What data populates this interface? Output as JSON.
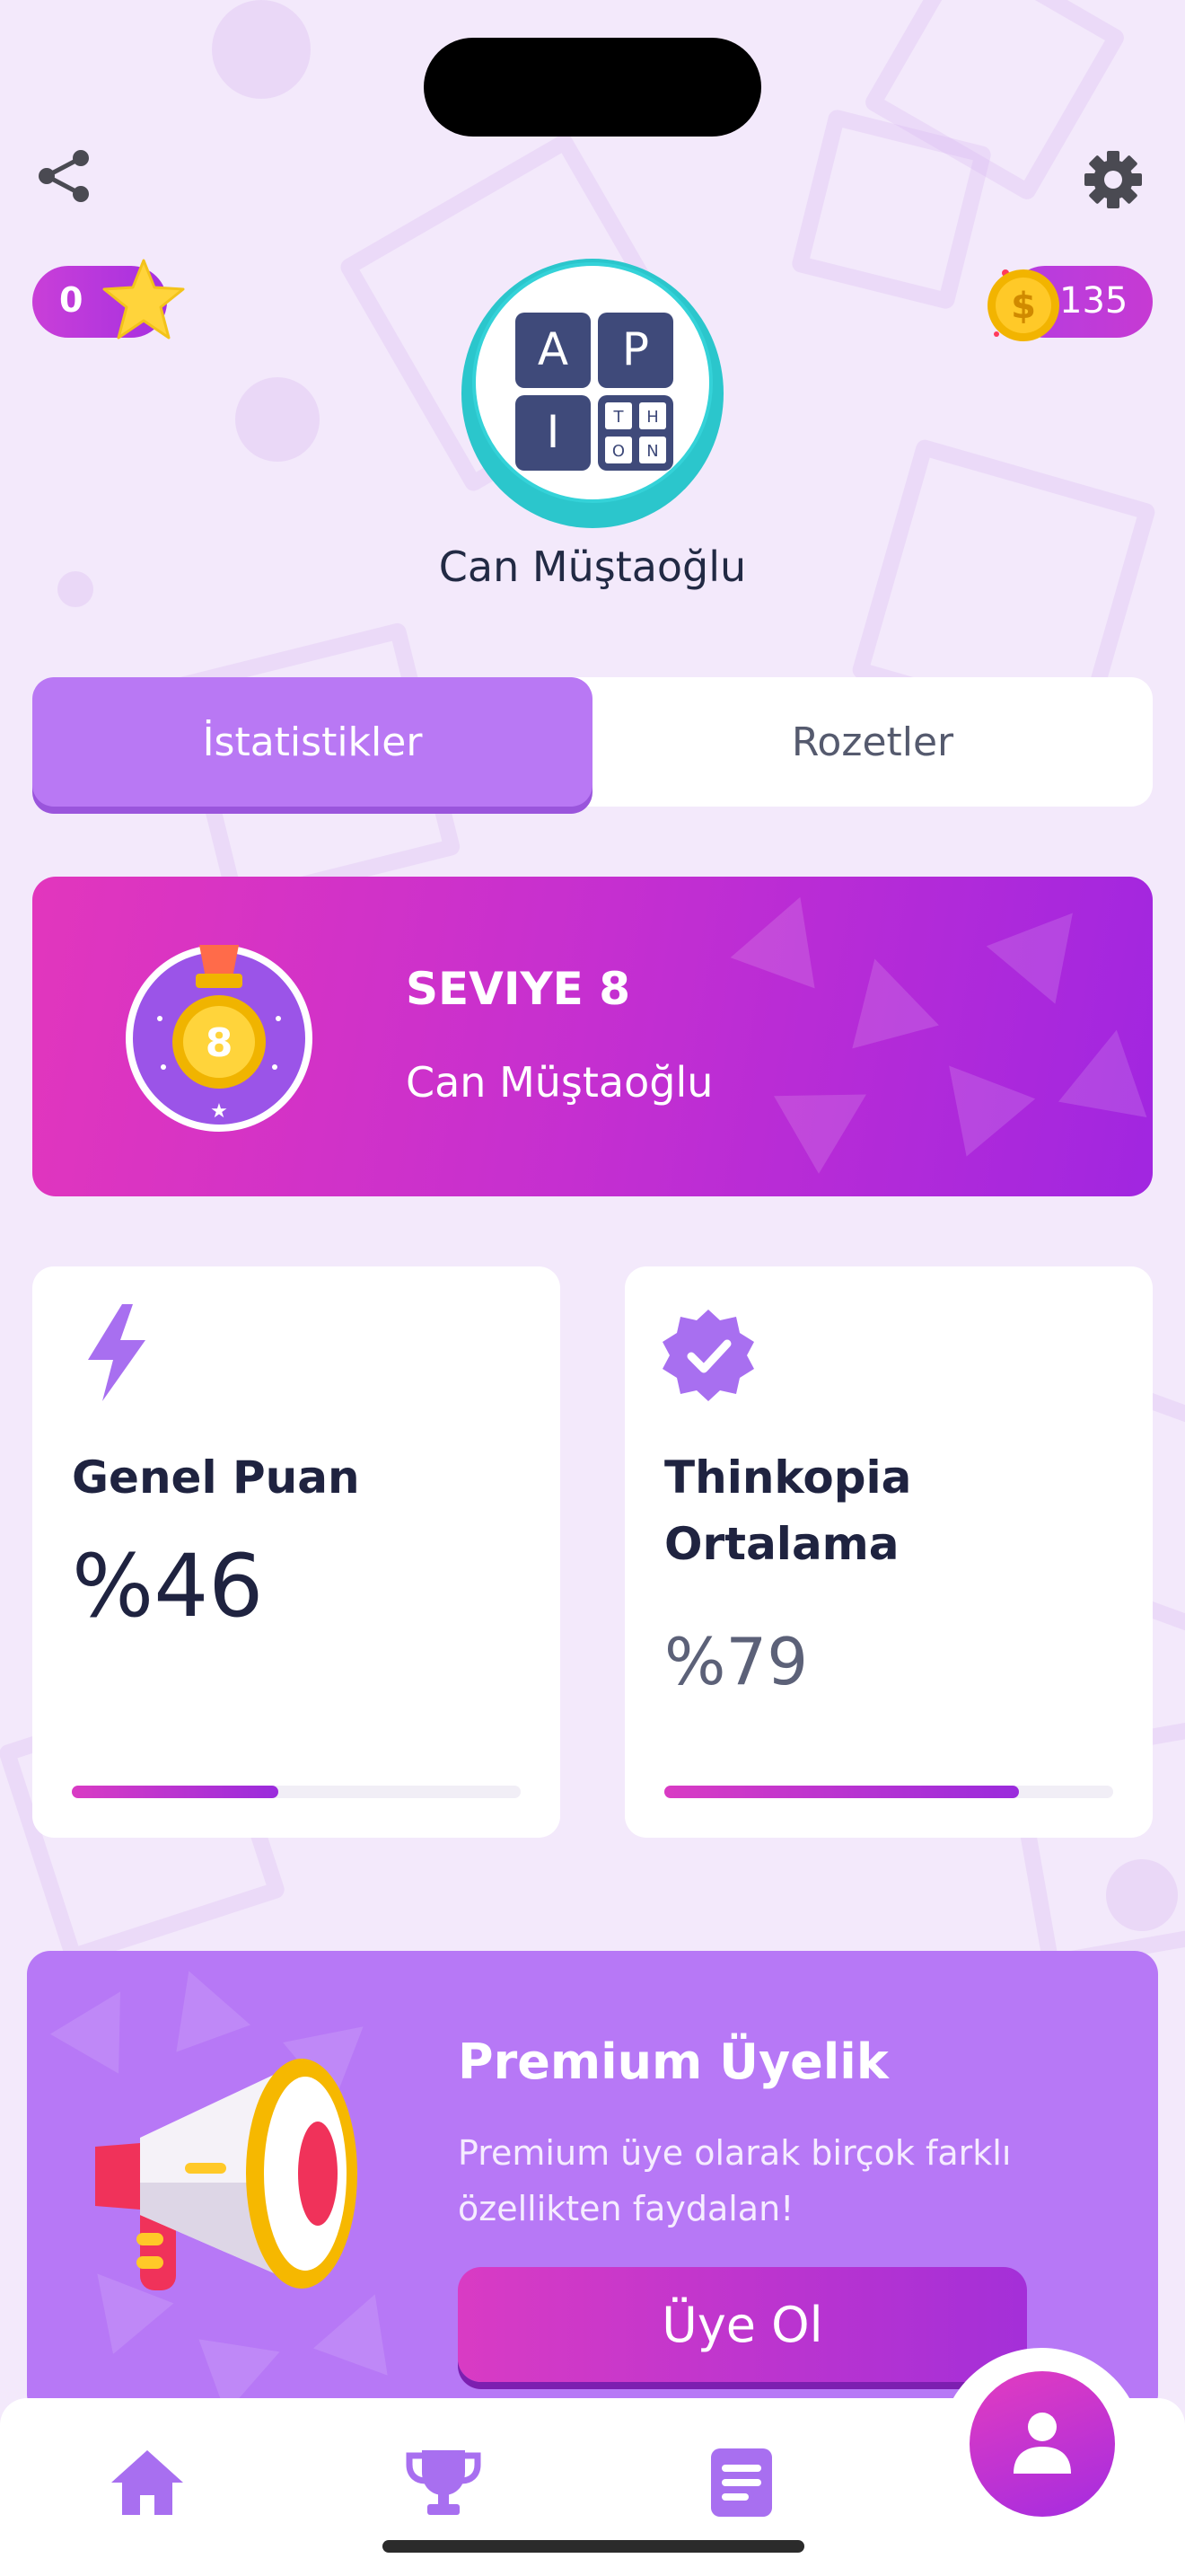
{
  "header": {
    "stars_count": "0",
    "coins_count": "135"
  },
  "profile": {
    "name": "Can Müştaoğlu",
    "logo_letters": [
      "A",
      "P",
      "I",
      "T",
      "H",
      "O",
      "N"
    ]
  },
  "tabs": [
    {
      "label": "İstatistikler",
      "active": true
    },
    {
      "label": "Rozetler",
      "active": false
    }
  ],
  "level_card": {
    "medal_number": "8",
    "title": "SEVIYE 8",
    "name": "Can Müştaoğlu"
  },
  "stats": [
    {
      "label": "Genel Puan",
      "value": "%46",
      "progress": 0.46,
      "icon": "lightning-icon"
    },
    {
      "label_line1": "Thinkopia",
      "label_line2": "Ortalama",
      "value": "%79",
      "progress": 0.79,
      "icon": "verified-badge-icon"
    }
  ],
  "premium": {
    "title": "Premium Üyelik",
    "description": "Premium üye olarak birçok farklı özellikten faydalan!",
    "button_label": "Üye Ol"
  },
  "colors": {
    "accent_purple": "#b978f4",
    "gradient_pink": "#e236bd",
    "gradient_violet": "#a126e0",
    "background": "#f3e9fb"
  },
  "nav": [
    "home-icon",
    "trophy-icon",
    "list-icon",
    "profile-icon"
  ]
}
